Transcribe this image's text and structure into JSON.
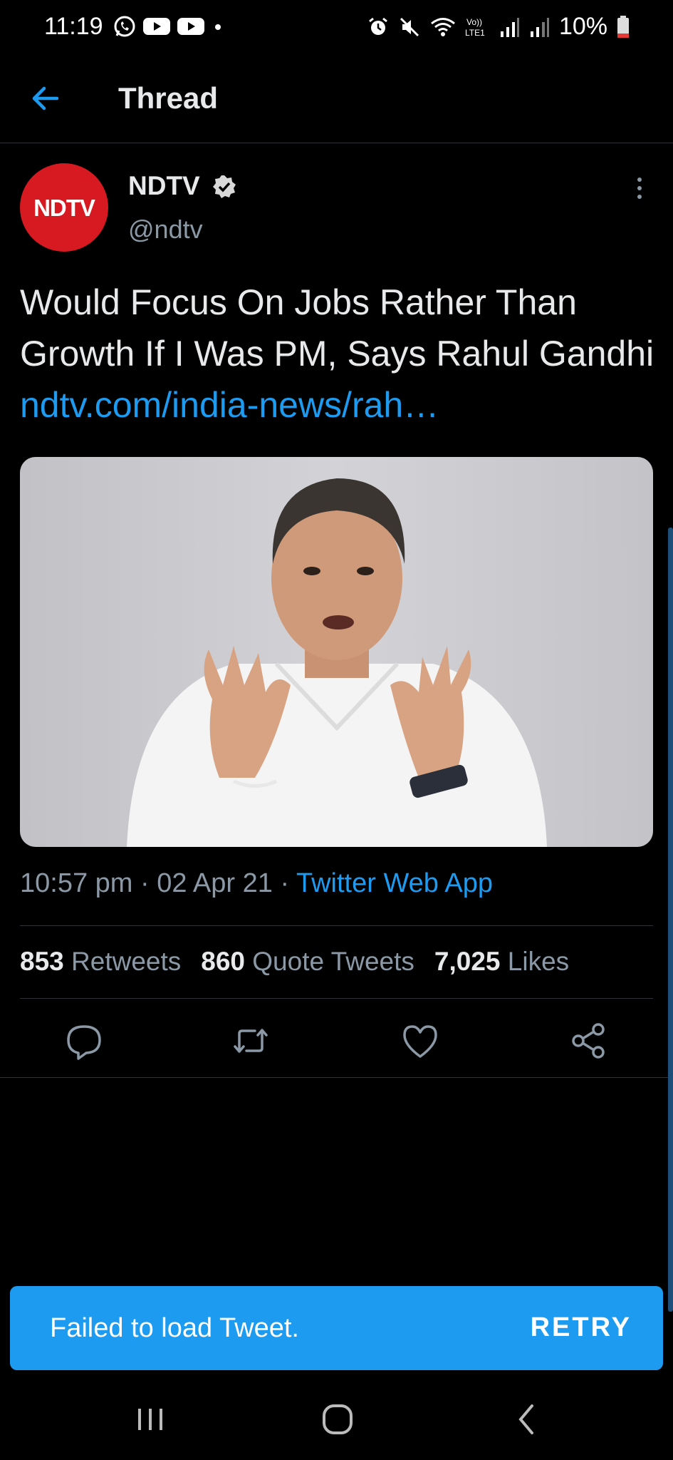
{
  "status_bar": {
    "time": "11:19",
    "battery": "10%",
    "left_icons": [
      "whatsapp-icon",
      "youtube-icon",
      "youtube-icon",
      "dot-icon"
    ],
    "right_icons": [
      "alarm-icon",
      "mute-icon",
      "wifi-icon",
      "lte-icon",
      "signal-icon",
      "signal-icon",
      "battery-icon"
    ]
  },
  "header": {
    "title": "Thread"
  },
  "tweet": {
    "avatar_text": "NDTV",
    "name": "NDTV",
    "handle": "@ndtv",
    "text": "Would Focus On Jobs Rather Than Growth If I Was PM, Says Rahul Gandhi ",
    "link": "ndtv.com/india-news/rah…",
    "time": "10:57 pm · 02 Apr 21 · ",
    "source": "Twitter Web App",
    "retweets_count": "853",
    "retweets_label": "Retweets",
    "quotes_count": "860",
    "quotes_label": "Quote Tweets",
    "likes_count": "7,025",
    "likes_label": "Likes"
  },
  "snackbar": {
    "message": "Failed to load Tweet.",
    "action": "RETRY"
  },
  "colors": {
    "accent": "#1d9bf0",
    "background": "#000000",
    "secondary_text": "#8b98a5",
    "brand_red": "#d71a21"
  }
}
